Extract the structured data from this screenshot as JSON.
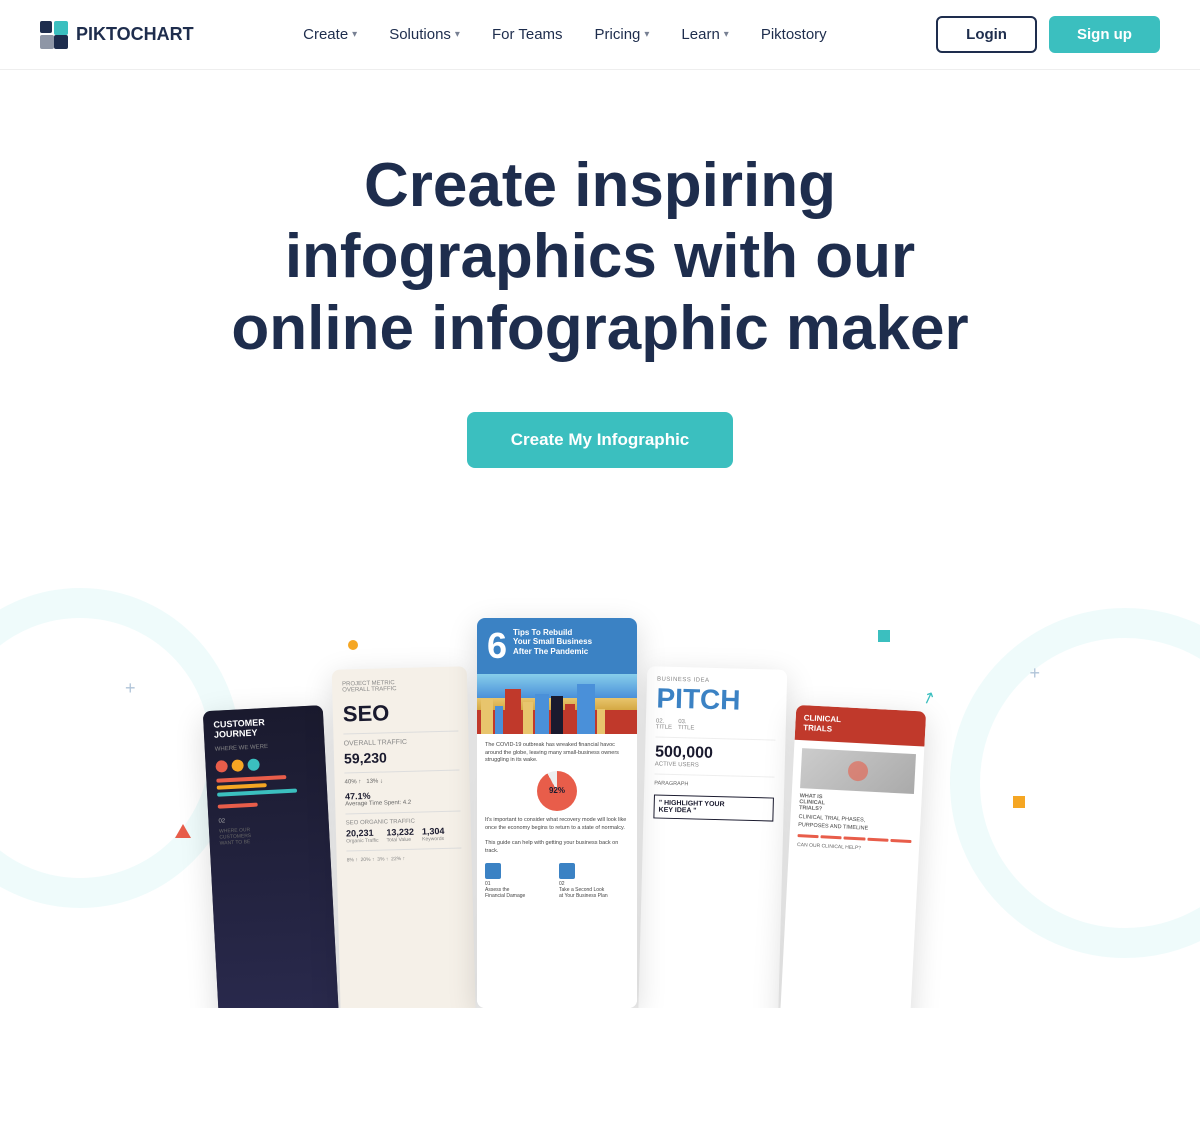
{
  "nav": {
    "logo_text": "PIKTOCHART",
    "links": [
      {
        "label": "Create",
        "has_dropdown": true
      },
      {
        "label": "Solutions",
        "has_dropdown": true
      },
      {
        "label": "For Teams",
        "has_dropdown": false
      },
      {
        "label": "Pricing",
        "has_dropdown": true
      },
      {
        "label": "Learn",
        "has_dropdown": true
      },
      {
        "label": "Piktostory",
        "has_dropdown": false
      }
    ],
    "login_label": "Login",
    "signup_label": "Sign up"
  },
  "hero": {
    "title": "Create inspiring infographics with our online infographic maker",
    "cta_label": "Create My Infographic"
  },
  "showcase": {
    "cards": [
      {
        "id": "customer",
        "type": "customer-journey",
        "title": "CUSTOMER journey"
      },
      {
        "id": "seo",
        "type": "seo",
        "title": "SEO",
        "stat": "59,230"
      },
      {
        "id": "tips",
        "type": "tips",
        "number": "6",
        "title": "Tips To Rebuild Your Small Business After The Pandemic",
        "percent": "92%"
      },
      {
        "id": "pitch",
        "type": "pitch",
        "label": "BUSINESS IDEA",
        "title": "PITCH",
        "stat": "500,000",
        "stat_label": "ACTIVE USERS",
        "quote": "\" HIGHLIGHT YOUR KEY IDEA \""
      },
      {
        "id": "clinical",
        "type": "clinical",
        "title": "CLINICAL TRIALS"
      }
    ]
  }
}
